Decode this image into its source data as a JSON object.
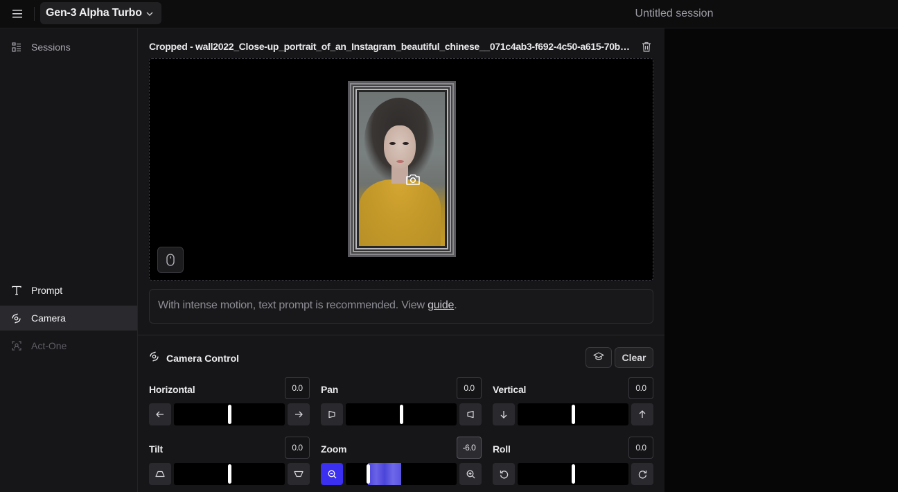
{
  "topbar": {
    "model_label": "Gen-3 Alpha Turbo",
    "session_title": "Untitled session"
  },
  "sidebar": {
    "items": [
      {
        "label": "Sessions",
        "icon": "sessions-grid-icon",
        "state": "normal"
      },
      {
        "label": "Prompt",
        "icon": "text-t-icon",
        "state": "normal"
      },
      {
        "label": "Camera",
        "icon": "camera-orbit-icon",
        "state": "selected"
      },
      {
        "label": "Act-One",
        "icon": "face-scan-icon",
        "state": "disabled"
      }
    ]
  },
  "main": {
    "filename": "Cropped - wall2022_Close-up_portrait_of_an_Instagram_beautiful_chinese__071c4ab3-f692-4c50-a615-70bcde...",
    "hint_text": "With intense motion, text prompt is recommended. View ",
    "hint_link": "guide",
    "hint_suffix": "."
  },
  "camera_control": {
    "title": "Camera Control",
    "clear_label": "Clear",
    "controls": [
      {
        "label": "Horizontal",
        "value": "0.0",
        "numeric": 0.0
      },
      {
        "label": "Pan",
        "value": "0.0",
        "numeric": 0.0
      },
      {
        "label": "Vertical",
        "value": "0.0",
        "numeric": 0.0
      },
      {
        "label": "Tilt",
        "value": "0.0",
        "numeric": 0.0
      },
      {
        "label": "Zoom",
        "value": "-6.0",
        "numeric": -6.0
      },
      {
        "label": "Roll",
        "value": "0.0",
        "numeric": 0.0
      }
    ],
    "range": [
      -10,
      10
    ]
  },
  "colors": {
    "accent": "#3b2ff0",
    "panel": "#161618",
    "background": "#0b0b0c"
  }
}
